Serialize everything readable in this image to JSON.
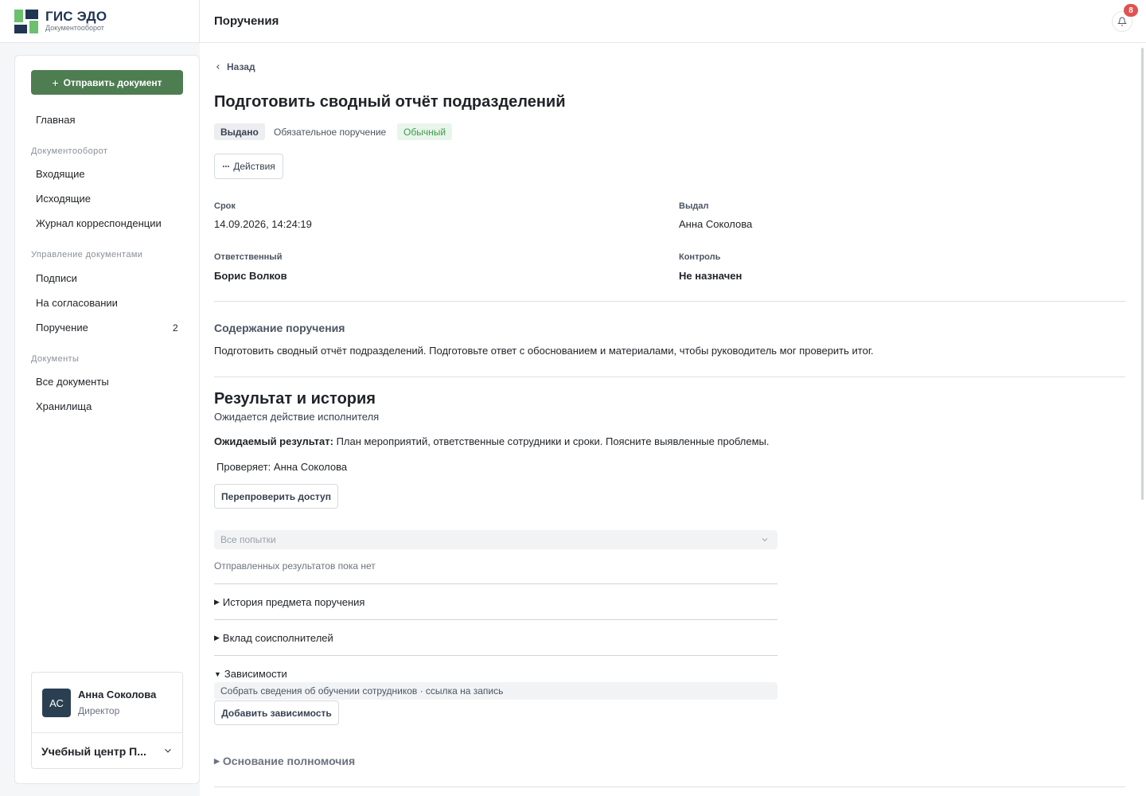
{
  "app": {
    "name": "ГИС ЭДО",
    "subtitle": "Документооборот"
  },
  "header": {
    "title": "Поручения",
    "notifications_count": "8"
  },
  "sidebar": {
    "send_button": "Отправить документ",
    "home": "Главная",
    "sections": [
      {
        "title": "Документооборот",
        "items": [
          "Входящие",
          "Исходящие",
          "Журнал корреспонденции"
        ]
      },
      {
        "title": "Управление документами",
        "items": [
          "Подписи",
          "На согласовании",
          "Поручение"
        ]
      },
      {
        "title": "Документы",
        "items": [
          "Все документы",
          "Хранилища"
        ]
      }
    ],
    "assignment_count": "2",
    "user": {
      "initials": "АС",
      "name": "Анна Соколова",
      "role": "Директор",
      "org": "Учебный центр П..."
    }
  },
  "main": {
    "back": "Назад",
    "title": "Подготовить сводный отчёт подразделений",
    "badges": {
      "status": "Выдано",
      "type": "Обязательное поручение",
      "priority": "Обычный"
    },
    "actions_button": "Действия",
    "fields": {
      "deadline_label": "Срок",
      "deadline_value": "14.09.2026, 14:24:19",
      "issuer_label": "Выдал",
      "issuer_value": "Анна Соколова",
      "responsible_label": "Ответственный",
      "responsible_value": "Борис Волков",
      "control_label": "Контроль",
      "control_value": "Не назначен"
    },
    "content": {
      "title": "Содержание поручения",
      "text": "Подготовить сводный отчёт подразделений. Подготовьте ответ с обоснованием и материалами, чтобы руководитель мог проверить итог."
    },
    "result": {
      "title": "Результат и история",
      "awaiting": "Ожидается действие исполнителя",
      "expected_label": "Ожидаемый результат:",
      "expected_text": "План мероприятий, ответственные сотрудники и сроки. Поясните выявленные проблемы.",
      "reviewer": "Проверяет: Анна Соколова",
      "recheck_button": "Перепроверить доступ",
      "attempts_select": "Все попытки",
      "no_results": "Отправленных результатов пока нет",
      "history": "История предмета поручения",
      "contribution": "Вклад соисполнителей",
      "dependencies": "Зависимости",
      "dependency_item": "Собрать сведения об обучении сотрудников · ссылка на запись",
      "add_dependency_button": "Добавить зависимость",
      "basis": "Основание полномочия"
    }
  },
  "colors": {
    "accent": "#4e7d52",
    "brand_dark": "#1f3553",
    "brand_green": "#6cc06e",
    "badge_red": "#e05252",
    "priority_green": "#3d9a4a"
  }
}
